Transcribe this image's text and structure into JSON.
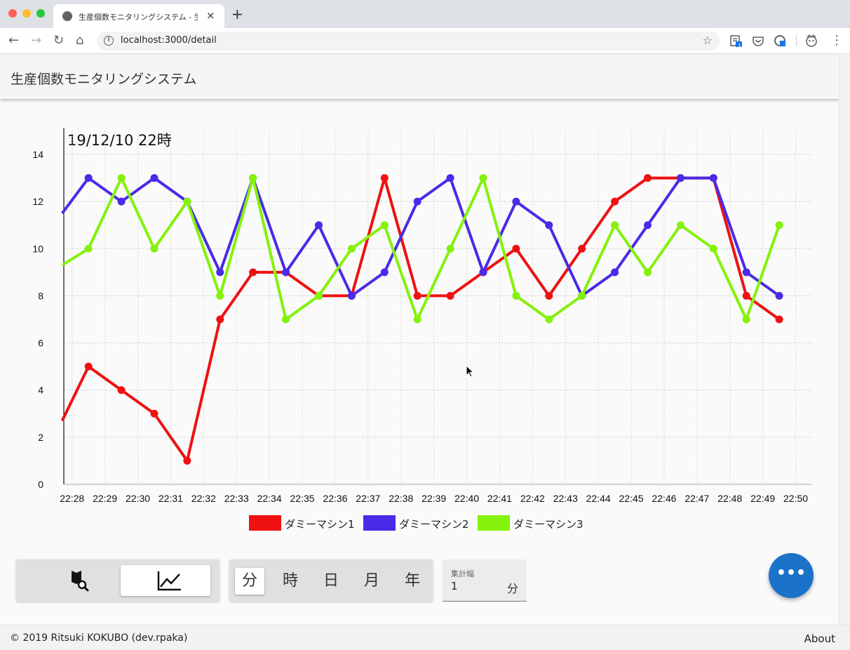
{
  "browser": {
    "tab_title": "生産個数モニタリングシステム - 生産個数",
    "tab_close": "×",
    "new_tab": "+",
    "url": "localhost:3000/detail",
    "omnibox_info": "i",
    "star": "☆",
    "nav_back": "←",
    "nav_forward": "→",
    "nav_reload": "↻",
    "nav_home": "⌂",
    "menu": "⋮",
    "extension_badge": "1",
    "traffic_colors": [
      "#ff5f57",
      "#febc2e",
      "#28c840"
    ]
  },
  "app": {
    "title": "生産個数モニタリングシステム"
  },
  "chart_data": {
    "type": "line",
    "title": "19/12/10 22時",
    "xlabel": "",
    "ylabel": "",
    "ylim": [
      0,
      14
    ],
    "yticks": [
      0,
      2,
      4,
      6,
      8,
      10,
      12,
      14
    ],
    "xlim": [
      27.75,
      50.5
    ],
    "xticks": [
      "22:28",
      "22:29",
      "22:30",
      "22:31",
      "22:32",
      "22:33",
      "22:34",
      "22:35",
      "22:36",
      "22:37",
      "22:38",
      "22:39",
      "22:40",
      "22:41",
      "22:42",
      "22:43",
      "22:44",
      "22:45",
      "22:46",
      "22:47",
      "22:48",
      "22:49",
      "22:50"
    ],
    "xtick_values": [
      28,
      29,
      30,
      31,
      32,
      33,
      34,
      35,
      36,
      37,
      38,
      39,
      40,
      41,
      42,
      43,
      44,
      45,
      46,
      47,
      48,
      49,
      50
    ],
    "x": [
      27.7,
      28.5,
      29.5,
      30.5,
      31.5,
      32.5,
      33.5,
      34.5,
      35.5,
      36.5,
      37.5,
      38.5,
      39.5,
      40.5,
      41.5,
      42.5,
      43.5,
      44.5,
      45.5,
      46.5,
      47.5,
      48.5,
      49.5
    ],
    "grid": true,
    "legend_position": "bottom",
    "series": [
      {
        "name": "ダミーマシン1",
        "color": "#ef1111",
        "values": [
          2.7,
          5,
          4,
          3,
          1,
          7,
          9,
          9,
          8,
          8,
          13,
          8,
          8,
          9,
          10,
          8,
          10,
          12,
          13,
          13,
          13,
          8,
          7
        ]
      },
      {
        "name": "ダミーマシン2",
        "color": "#4b2ae8",
        "values": [
          11.5,
          13,
          12,
          13,
          12,
          9,
          13,
          9,
          11,
          8,
          9,
          12,
          13,
          9,
          12,
          11,
          8,
          9,
          11,
          13,
          13,
          9,
          8
        ]
      },
      {
        "name": "ダミーマシン3",
        "color": "#84f20a",
        "values": [
          9.3,
          10,
          13,
          10,
          12,
          8,
          13,
          7,
          8,
          10,
          11,
          7,
          10,
          13,
          8,
          7,
          8,
          11,
          9,
          11,
          10,
          7,
          11
        ]
      }
    ]
  },
  "controls": {
    "units": [
      "分",
      "時",
      "日",
      "月",
      "年"
    ],
    "active_unit": "分",
    "aggregation": {
      "label": "集計幅",
      "value": "1",
      "suffix": "分"
    },
    "fab_label": "•••"
  },
  "footer": {
    "copyright": "© 2019 Ritsuki KOKUBO (dev.rpaka)",
    "about": "About"
  }
}
